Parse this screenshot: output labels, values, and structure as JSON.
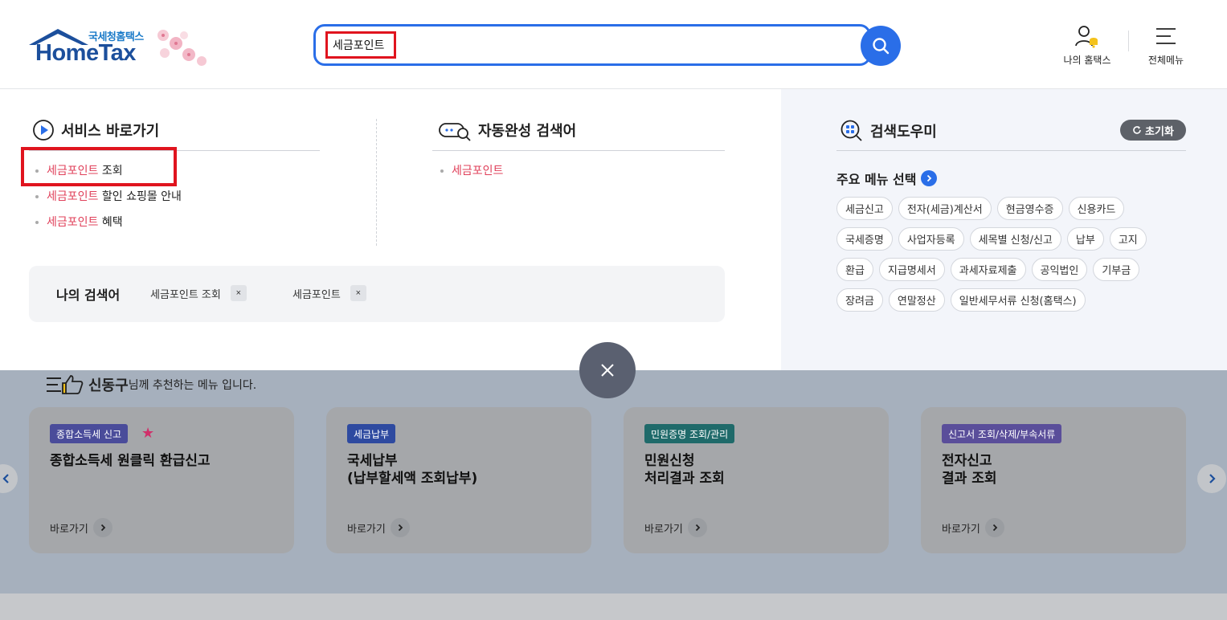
{
  "header": {
    "logo_small": "국세청홈택스",
    "logo_main": "HomeTax",
    "search_value": "세금포인트",
    "my_hometax": "나의 홈택스",
    "all_menu": "전체메뉴"
  },
  "service_shortcut": {
    "title": "서비스 바로가기",
    "items": [
      {
        "highlight": "세금포인트",
        "rest": " 조회"
      },
      {
        "highlight": "세금포인트",
        "rest": " 할인 쇼핑몰 안내"
      },
      {
        "highlight": "세금포인트",
        "rest": " 혜택"
      }
    ]
  },
  "autocomplete": {
    "title": "자동완성 검색어",
    "items": [
      {
        "highlight": "세금포인트"
      }
    ]
  },
  "my_search": {
    "title": "나의 검색어",
    "items": [
      "세금포인트 조회",
      "세금포인트"
    ],
    "remove_label": "×"
  },
  "helper": {
    "title": "검색도우미",
    "reset_label": "초기화",
    "menu_title": "주요 메뉴 선택",
    "tag_rows": [
      [
        "세금신고",
        "전자(세금)계산서",
        "현금영수증",
        "신용카드"
      ],
      [
        "국세증명",
        "사업자등록",
        "세목별 신청/신고",
        "납부",
        "고지"
      ],
      [
        "환급",
        "지급명세서",
        "과세자료제출",
        "공익법인",
        "기부금"
      ],
      [
        "장려금",
        "연말정산",
        "일반세무서류 신청(홈택스)"
      ]
    ]
  },
  "recommend": {
    "user_name": "신동구",
    "suffix": "님께 추천하는 메뉴 입니다.",
    "go_label": "바로가기",
    "cards": [
      {
        "badge": "종합소득세 신고",
        "badge_color": "#4a4c9a",
        "title_line1": "종합소득세 원클릭 환급신고",
        "title_line2": ""
      },
      {
        "badge": "세금납부",
        "badge_color": "#2e4aa0",
        "title_line1": "국세납부",
        "title_line2": "(납부할세액 조회납부)"
      },
      {
        "badge": "민원증명 조회/관리",
        "badge_color": "#1f6a6a",
        "title_line1": "민원신청",
        "title_line2": "처리결과 조회"
      },
      {
        "badge": "신고서 조회/삭제/부속서류",
        "badge_color": "#5a4e9a",
        "title_line1": "전자신고",
        "title_line2": "결과 조회"
      }
    ]
  },
  "colors": {
    "accent": "#2a6ee8",
    "highlight": "#e0405a",
    "annotation_red": "#e0141e"
  }
}
